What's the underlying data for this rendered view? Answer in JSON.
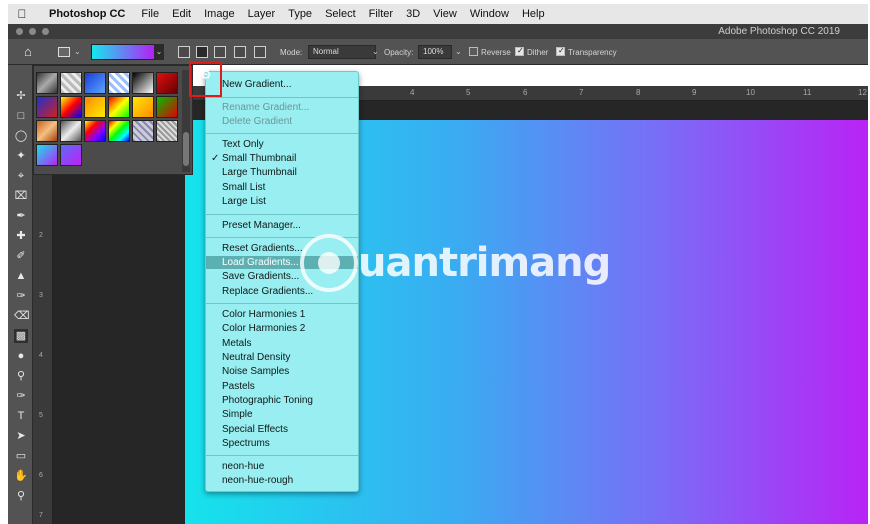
{
  "mac_menu": {
    "apple": "",
    "app": "Photoshop CC",
    "items": [
      "File",
      "Edit",
      "Image",
      "Layer",
      "Type",
      "Select",
      "Filter",
      "3D",
      "View",
      "Window",
      "Help"
    ]
  },
  "window": {
    "title": "Adobe Photoshop CC 2019"
  },
  "options_bar": {
    "mode_label": "Mode:",
    "mode_value": "Normal",
    "opacity_label": "Opacity:",
    "opacity_value": "100%",
    "reverse_label": "Reverse",
    "reverse_checked": false,
    "dither_label": "Dither",
    "dither_checked": true,
    "transparency_label": "Transparency",
    "transparency_checked": true
  },
  "ruler_h_ticks": [
    "4",
    "5",
    "6",
    "7",
    "8",
    "9",
    "10",
    "11",
    "12"
  ],
  "ruler_v_ticks": [
    "2",
    "3",
    "4",
    "5",
    "6",
    "7"
  ],
  "gradient_menu": {
    "new": "New Gradient...",
    "rename": "Rename Gradient...",
    "delete": "Delete Gradient",
    "view": [
      "Text Only",
      "Small Thumbnail",
      "Large Thumbnail",
      "Small List",
      "Large List"
    ],
    "view_selected": "Small Thumbnail",
    "preset_manager": "Preset Manager...",
    "actions": [
      "Reset Gradients...",
      "Load Gradients...",
      "Save Gradients...",
      "Replace Gradients..."
    ],
    "highlighted": "Load Gradients...",
    "libraries": [
      "Color Harmonies 1",
      "Color Harmonies 2",
      "Metals",
      "Neutral Density",
      "Noise Samples",
      "Pastels",
      "Photographic Toning",
      "Simple",
      "Special Effects",
      "Spectrums"
    ],
    "custom": [
      "neon-hue",
      "neon-hue-rough"
    ]
  },
  "watermark": {
    "text": "uantrimang"
  },
  "colors": {
    "canvas_start": "#15e3ec",
    "canvas_end": "#b923f5",
    "menu_bg": "#98eef0",
    "highlight": "#e21a1a"
  }
}
